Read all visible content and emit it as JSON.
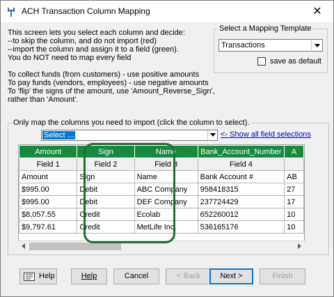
{
  "window": {
    "title": "ACH Transaction Column Mapping",
    "close_glyph": "✕"
  },
  "intro_text": "This screen lets you select each column and decide:\n--to skip the column, and do not import (red)\n--import the column and assign it to a field (green).\nYou do NOT need to map every field\n\nTo collect funds (from customers) - use positive amounts\nTo pay funds (vendors, employees) - use negative amounts\nTo 'flip' the signs of the amount, use 'Amount_Reverse_Sign',\nrather than 'Amount'.",
  "template": {
    "legend": "Select a Mapping Template",
    "selected": "Transactions",
    "save_default_label": "save as default",
    "save_default_checked": false
  },
  "mapping": {
    "legend": "Only map the columns you need to import (click the column to select).",
    "field_select_value": "Select ...",
    "show_all_link": "<- Show all field selections"
  },
  "grid": {
    "columns": [
      "Amount",
      "Sign",
      "Name",
      "Bank_Account_Number",
      "A"
    ],
    "fields": [
      "Field 1",
      "Field 2",
      "Field 3",
      "Field 4",
      ""
    ],
    "rows": [
      [
        "Amount",
        "Sign",
        "Name",
        "Bank Account #",
        "AB"
      ],
      [
        "$995.00",
        "Debit",
        "ABC Company",
        "958418315",
        "27"
      ],
      [
        "$995.00",
        "Debit",
        "DEF Company",
        "237724429",
        "17"
      ],
      [
        "$8,057.55",
        "Credit",
        "Ecolab",
        "652260012",
        "10"
      ],
      [
        "$9,797.61",
        "Credit",
        "MetLife Inc.",
        "536165176",
        "10"
      ]
    ]
  },
  "buttons": {
    "help_icon_label": "Help",
    "help": "Help",
    "cancel": "Cancel",
    "back": "< Back",
    "next": "Next >",
    "finish": "Finish"
  },
  "colors": {
    "header_green": "#178a3e",
    "highlight_green": "#1f6f31",
    "link_blue": "#0000cc"
  }
}
